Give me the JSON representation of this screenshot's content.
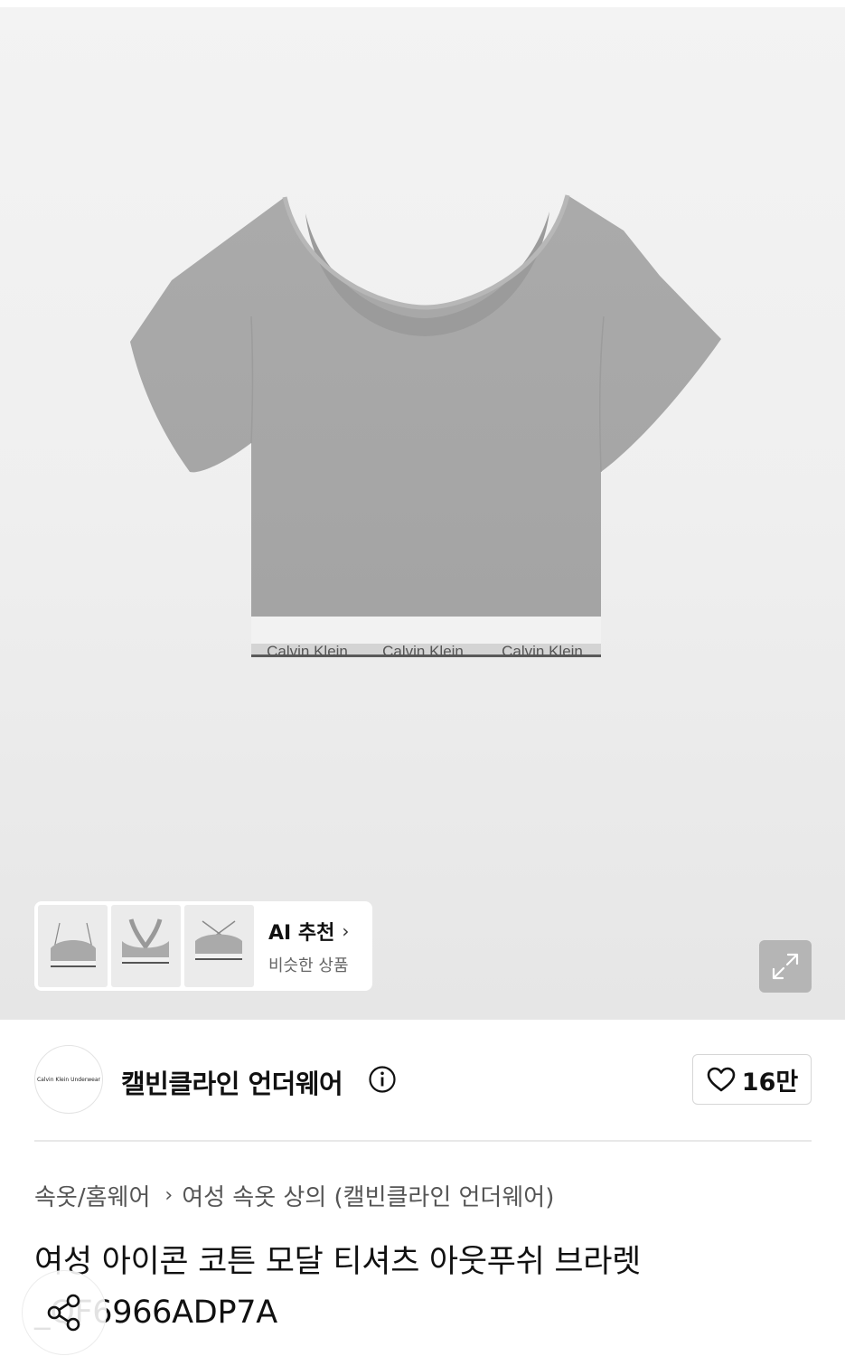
{
  "gallery": {
    "thumb_images": [
      "bralette-thumb",
      "racerback-bralette-thumb",
      "crossback-bralette-thumb"
    ],
    "shirt_brand_text": [
      "Calvin Klein",
      "Calvin Klein",
      "Calvin Klein"
    ],
    "ai_title": "AI 추천",
    "ai_subtitle": "비슷한 상품",
    "expand_icon": "expand-icon"
  },
  "brand": {
    "logo_text": "Calvin Klein Underwear",
    "name": "캘빈클라인 언더웨어",
    "info_icon": "info-icon",
    "like_icon": "heart-icon",
    "like_count": "16만"
  },
  "breadcrumb": {
    "level1": "속옷/홈웨어",
    "separator_icon": "chevron-right-icon",
    "level2": "여성 속옷 상의 (캘빈클라인 언더웨어)"
  },
  "product": {
    "title": "여성 아이콘 코튼 모달 티셔츠 아웃푸쉬 브라렛_QF6966ADP7A"
  },
  "share": {
    "icon": "share-icon"
  },
  "colors": {
    "background": "#ffffff",
    "hero_background": "#efefef",
    "shirt_gray": "#a9a9a9",
    "text_primary": "#111111",
    "text_secondary": "#555555"
  }
}
